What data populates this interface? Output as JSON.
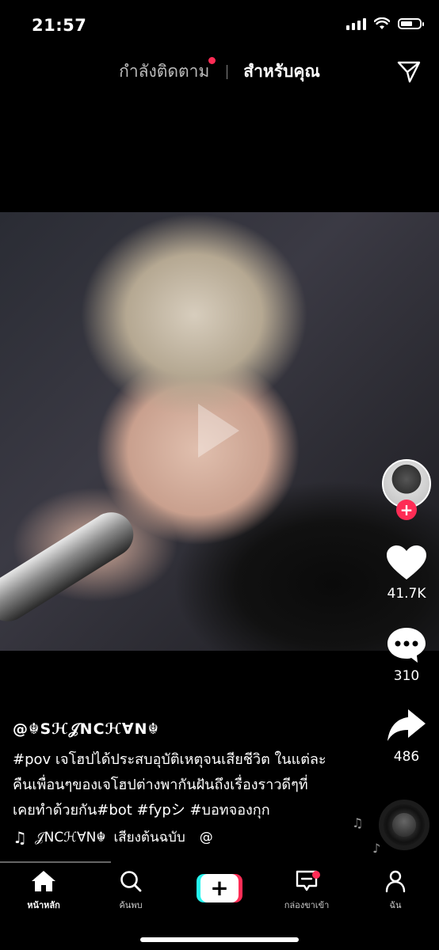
{
  "status_bar": {
    "time": "21:57"
  },
  "top_tabs": {
    "following": "กำลังติดตาม",
    "for_you": "สำหรับคุณ"
  },
  "rail": {
    "likes": "41.7K",
    "comments": "310",
    "shares": "486"
  },
  "post": {
    "username": "@☬Sℋ𝒥NCℋ∀N☬",
    "caption_line1": "#pov เจโฮปได้ประสบอุบัติเหตุจนเสียชีวิต ในแต่ละ",
    "caption_line2": "คืนเพื่อนๆของเจโฮปต่างพากันฝันถึงเรื่องราวดีๆที่",
    "caption_line3": "เคยทำด้วยกัน#bot #fypシ #บอทจองกุก",
    "music_note": "♫",
    "music_artist": "𝒥NCℋ∀N☬",
    "music_title": "เสียงต้นฉบับ",
    "music_at": "@"
  },
  "bottom_nav": {
    "home": "หน้าหลัก",
    "discover": "ค้นพบ",
    "create": "+",
    "inbox": "กล่องขาเข้า",
    "me": "ฉัน"
  },
  "colors": {
    "accent_red": "#fe2c55",
    "accent_cyan": "#25f4ee",
    "background": "#000000"
  },
  "icons": [
    "signal-icon",
    "wifi-icon",
    "battery-icon",
    "share-arrow-icon",
    "play-icon",
    "heart-icon",
    "comment-icon",
    "share-icon",
    "music-note-icon",
    "home-icon",
    "search-icon",
    "inbox-icon",
    "profile-icon"
  ]
}
